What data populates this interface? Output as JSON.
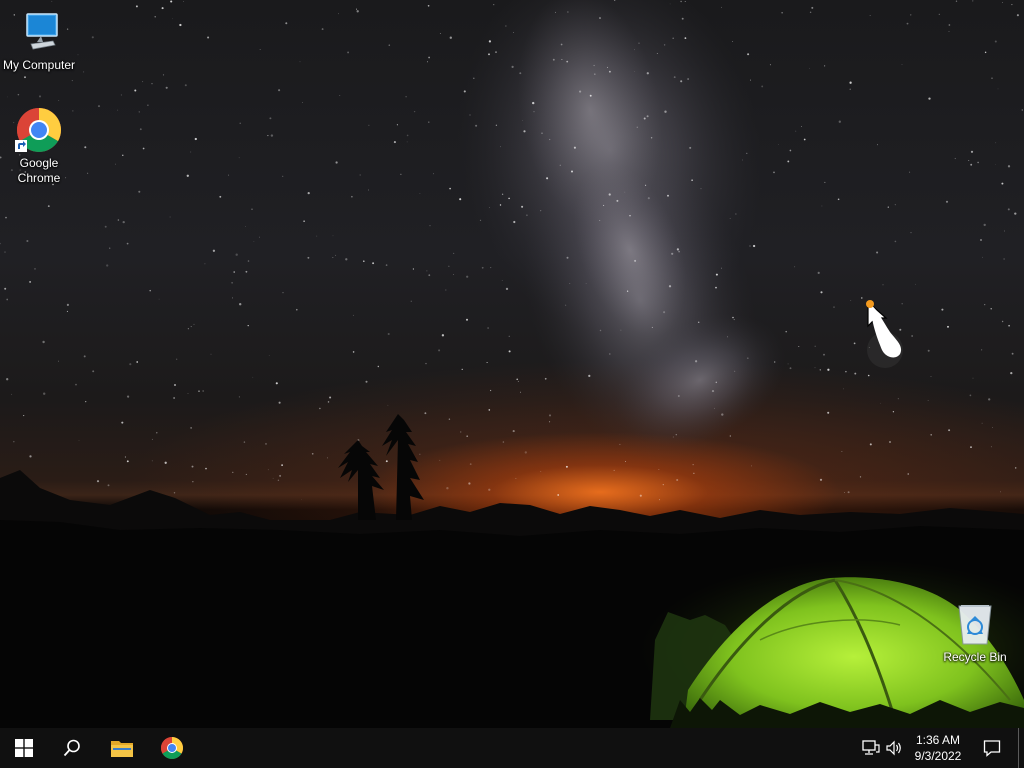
{
  "desktop": {
    "icons": [
      {
        "label": "My Computer",
        "icon": "computer-icon"
      },
      {
        "label": "Google Chrome",
        "icon": "chrome-icon"
      },
      {
        "label": "Recycle Bin",
        "icon": "recycle-bin-icon"
      }
    ]
  },
  "taskbar": {
    "start_icon": "windows-logo-icon",
    "search_icon": "search-icon",
    "pinned": [
      {
        "name": "File Explorer",
        "icon": "folder-icon"
      },
      {
        "name": "Google Chrome",
        "icon": "chrome-icon"
      }
    ],
    "tray": {
      "network_icon": "network-icon",
      "volume_icon": "volume-icon",
      "time": "1:36 AM",
      "date": "9/3/2022",
      "notification_icon": "notification-icon"
    }
  },
  "colors": {
    "taskbar_bg": "#101010",
    "tent_green": "#8fd42a",
    "horizon_glow": "#ff7a1e",
    "folder_yellow": "#f4c445"
  }
}
